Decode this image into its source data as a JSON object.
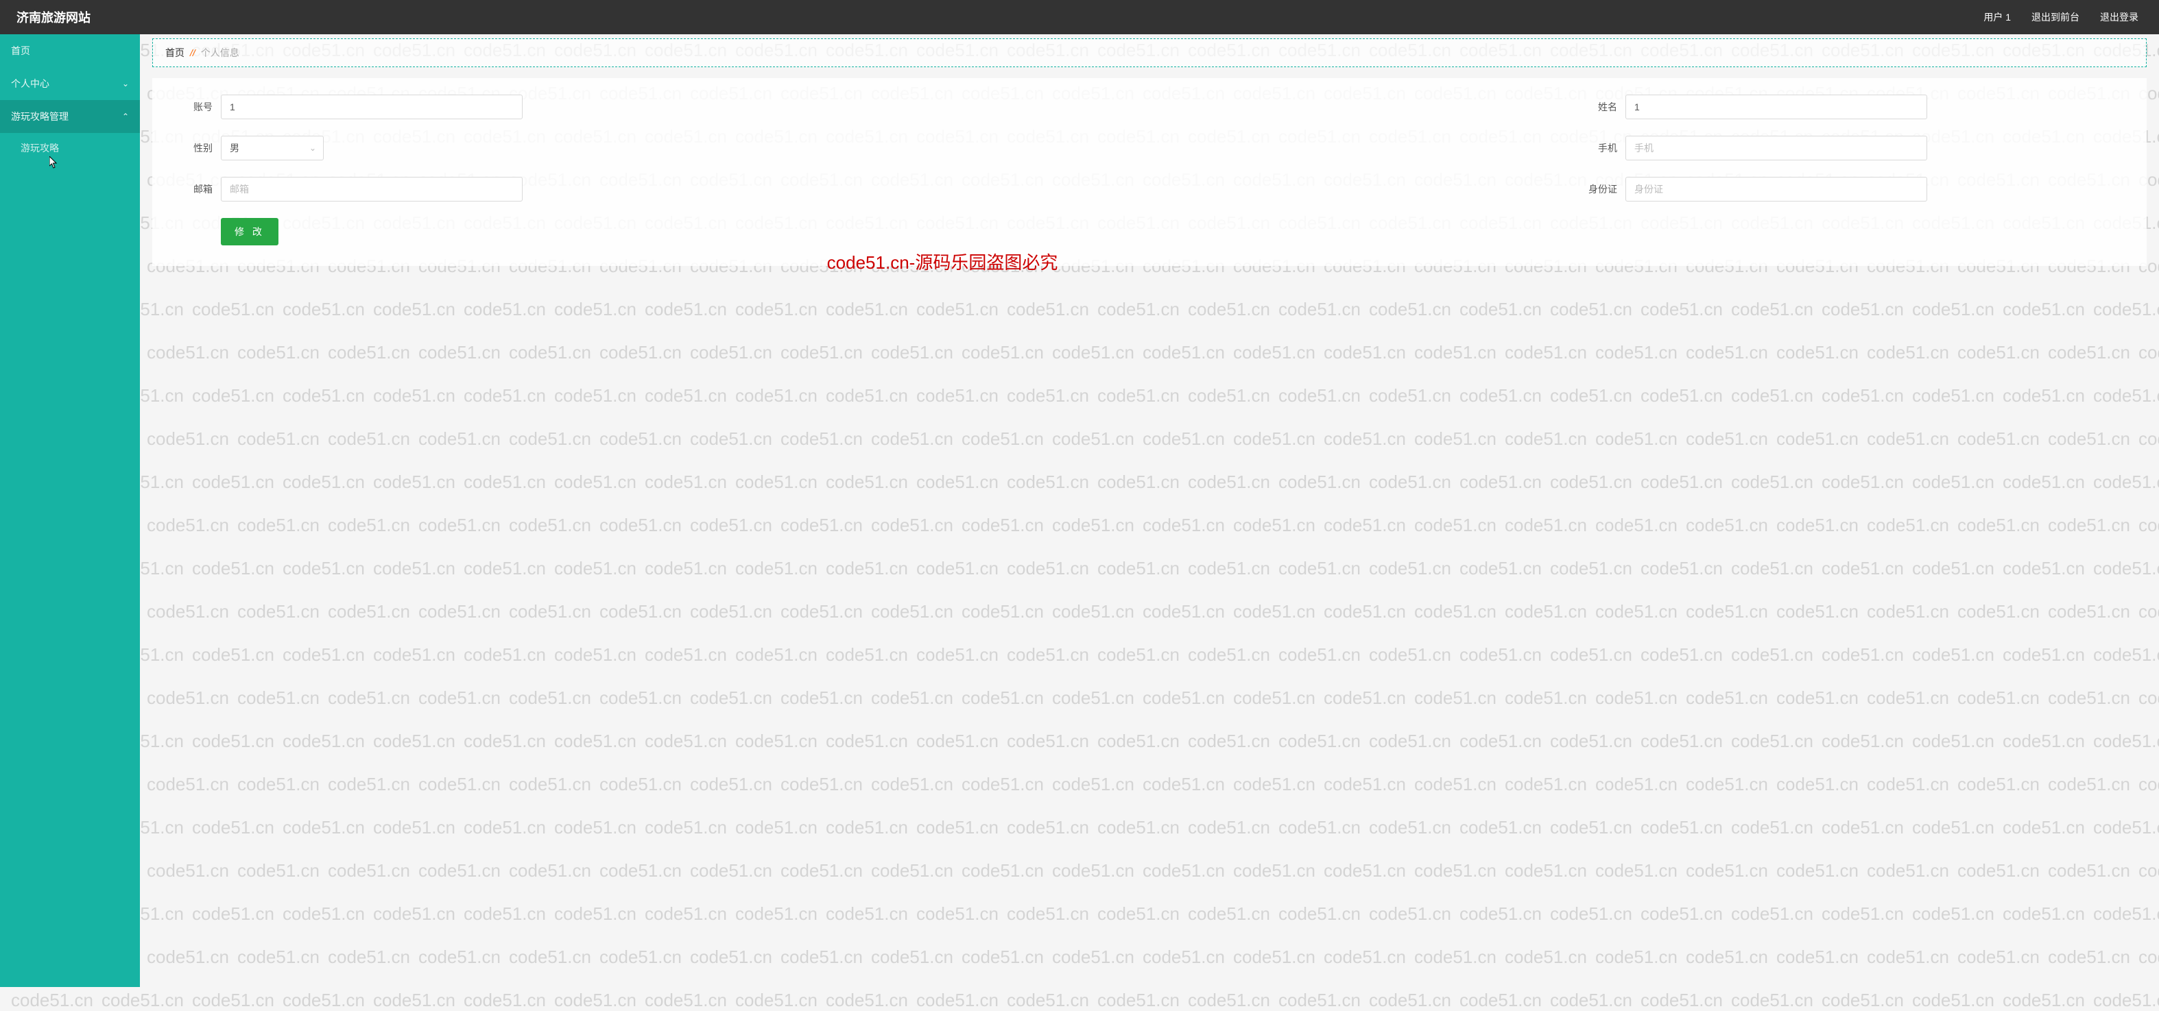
{
  "header": {
    "title": "济南旅游网站",
    "user": "用户 1",
    "exit_front": "退出到前台",
    "logout": "退出登录"
  },
  "sidebar": {
    "home": "首页",
    "personal_center": "个人中心",
    "travel_guide_mgmt": "游玩攻略管理",
    "travel_guide": "游玩攻略"
  },
  "breadcrumb": {
    "home": "首页",
    "separator": "//",
    "current": "个人信息"
  },
  "form": {
    "account_label": "账号",
    "account_value": "1",
    "name_label": "姓名",
    "name_value": "1",
    "gender_label": "性别",
    "gender_value": "男",
    "phone_label": "手机",
    "phone_placeholder": "手机",
    "email_label": "邮箱",
    "email_placeholder": "邮箱",
    "idcard_label": "身份证",
    "idcard_placeholder": "身份证",
    "submit": "修 改"
  },
  "watermark": "code51.cn",
  "copyright": "code51.cn-源码乐园盗图必究"
}
